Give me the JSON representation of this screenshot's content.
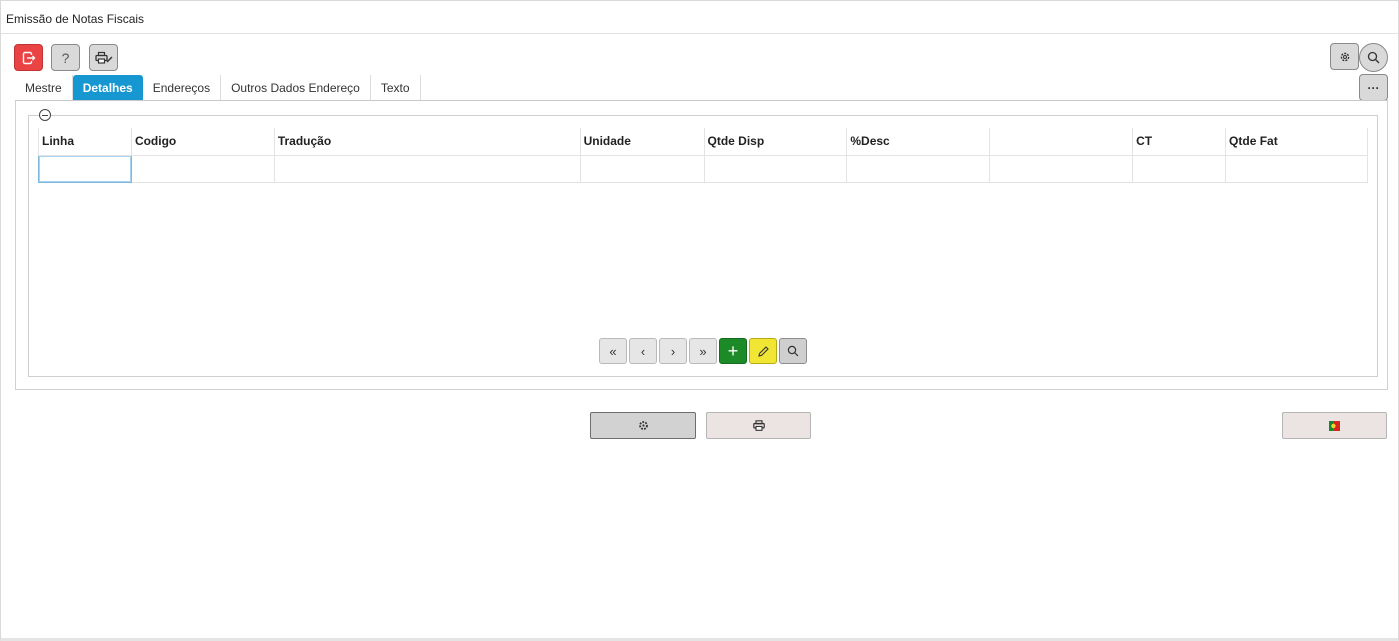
{
  "window": {
    "title": "Emissão de Notas Fiscais"
  },
  "toolbar": {
    "exit_icon": "exit-icon",
    "help_label": "?",
    "print_icon": "printer-edit-icon",
    "settings_icon": "gear-icon",
    "search_icon": "search-icon",
    "more_label": "···"
  },
  "tabs": [
    {
      "label": "Mestre",
      "active": false
    },
    {
      "label": "Detalhes",
      "active": true
    },
    {
      "label": "Endereços",
      "active": false
    },
    {
      "label": "Outros Dados Endereço",
      "active": false
    },
    {
      "label": "Texto",
      "active": false
    }
  ],
  "grid": {
    "columns": [
      "Linha",
      "Codigo",
      "Tradução",
      "Unidade",
      "Qtde Disp",
      "%Desc",
      "",
      "CT",
      "Qtde Fat"
    ],
    "rows": [
      [
        "",
        "",
        "",
        "",
        "",
        "",
        "",
        "",
        ""
      ]
    ]
  },
  "pager": {
    "first_label": "«",
    "prev_label": "‹",
    "next_label": "›",
    "last_label": "»",
    "add_label": "+",
    "edit_icon": "pencil-icon",
    "search_icon": "search-icon"
  },
  "actions": {
    "settings_icon": "gear-icon",
    "print_icon": "printer-icon",
    "flag_icon": "flag-portugal-icon"
  },
  "colors": {
    "active_tab": "#1797d1",
    "exit_button": "#ea4343",
    "add_button": "#1d8a28",
    "edit_button": "#f1e634"
  }
}
